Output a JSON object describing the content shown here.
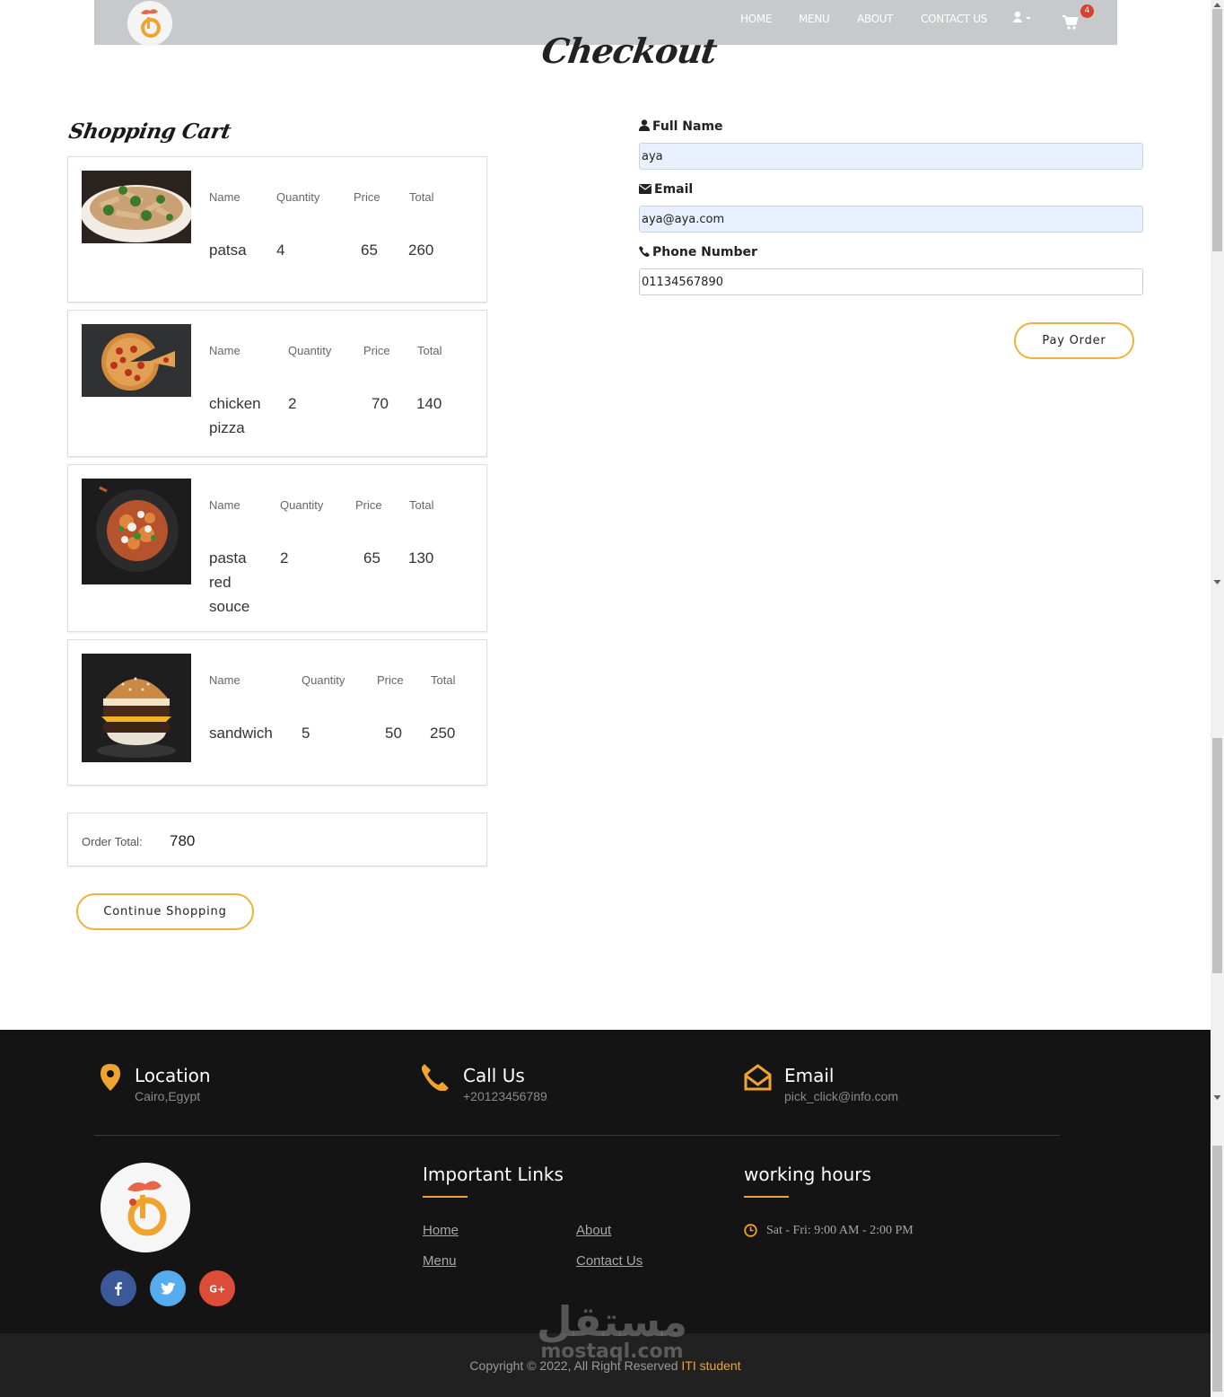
{
  "nav": {
    "links": [
      "HOME",
      "MENU",
      "ABOUT",
      "CONTACT US"
    ],
    "cart_count": "4"
  },
  "page_title": "Checkout",
  "cart": {
    "heading": "Shopping Cart",
    "col_headers": {
      "name": "Name",
      "quantity": "Quantity",
      "price": "Price",
      "total": "Total"
    },
    "items": [
      {
        "name": "patsa",
        "quantity": "4",
        "price": "65",
        "total": "260",
        "image": "pasta-broccoli"
      },
      {
        "name": "chicken pizza",
        "quantity": "2",
        "price": "70",
        "total": "140",
        "image": "pizza"
      },
      {
        "name": "pasta red souce",
        "quantity": "2",
        "price": "65",
        "total": "130",
        "image": "pasta-red-sauce"
      },
      {
        "name": "sandwich",
        "quantity": "5",
        "price": "50",
        "total": "250",
        "image": "burger"
      }
    ],
    "order_total_label": "Order Total:",
    "order_total_value": "780",
    "continue_label": "Continue Shopping"
  },
  "form": {
    "full_name_label": "Full Name",
    "full_name_value": "aya",
    "email_label": "Email",
    "email_value": "aya@aya.com",
    "phone_label": "Phone Number",
    "phone_value": "01134567890",
    "pay_label": "Pay Order"
  },
  "footer": {
    "location_title": "Location",
    "location_value": "Cairo,Egypt",
    "call_title": "Call Us",
    "call_value": "+20123456789",
    "email_title": "Email",
    "email_value": "pick_click@info.com",
    "links_heading": "Important Links",
    "links": [
      "Home",
      "About",
      "Menu",
      "Contact Us"
    ],
    "hours_heading": "working hours",
    "hours_value": "Sat - Fri: 9:00 AM - 2:00 PM",
    "copyright_text": "Copyright © 2022, All Right Reserved",
    "copyright_accent": "ITI student"
  },
  "watermark": {
    "arabic": "مستقل",
    "latin": "mostaql.com"
  },
  "colors": {
    "accent": "#f0a32e",
    "navbar": "#c8c9cb",
    "footer": "#141414",
    "badge": "#d9412c"
  }
}
